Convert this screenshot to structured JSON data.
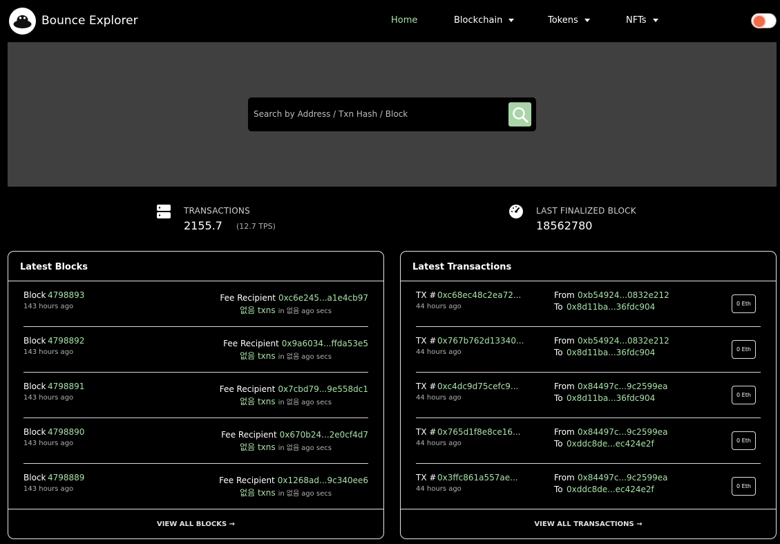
{
  "nav": {
    "brand": "Bounce Explorer",
    "home": "Home",
    "blockchain": "Blockchain",
    "tokens": "Tokens",
    "nfts": "NFTs"
  },
  "search": {
    "placeholder": "Search by Address / Txn Hash / Block"
  },
  "stats": {
    "transactions_label": "TRANSACTIONS",
    "transactions_value": "2155.7",
    "transactions_tps": "(12.7 TPS)",
    "finalized_label": "LAST FINALIZED BLOCK",
    "finalized_value": "18562780"
  },
  "blocks": {
    "title": "Latest Blocks",
    "view_all": "VIEW ALL BLOCKS →",
    "items": [
      {
        "label": "Block",
        "number": "4798893",
        "age": "143 hours ago",
        "fee_label": "Fee Recipient",
        "fee": "0xc6e245...a1e4cb97",
        "txns": "없음 txns",
        "in_label": "in",
        "in_value": "없음",
        "secs": "ago secs"
      },
      {
        "label": "Block",
        "number": "4798892",
        "age": "143 hours ago",
        "fee_label": "Fee Recipient",
        "fee": "0x9a6034...ffda53e5",
        "txns": "없음 txns",
        "in_label": "in",
        "in_value": "없음",
        "secs": "ago secs"
      },
      {
        "label": "Block",
        "number": "4798891",
        "age": "143 hours ago",
        "fee_label": "Fee Recipient",
        "fee": "0x7cbd79...9e558dc1",
        "txns": "없음 txns",
        "in_label": "in",
        "in_value": "없음",
        "secs": "ago secs"
      },
      {
        "label": "Block",
        "number": "4798890",
        "age": "143 hours ago",
        "fee_label": "Fee Recipient",
        "fee": "0x670b24...2e0cf4d7",
        "txns": "없음 txns",
        "in_label": "in",
        "in_value": "없음",
        "secs": "ago secs"
      },
      {
        "label": "Block",
        "number": "4798889",
        "age": "143 hours ago",
        "fee_label": "Fee Recipient",
        "fee": "0x1268ad...9c340ee6",
        "txns": "없음 txns",
        "in_label": "in",
        "in_value": "없음",
        "secs": "ago secs"
      }
    ]
  },
  "transactions": {
    "title": "Latest Transactions",
    "view_all": "VIEW ALL TRANSACTIONS →",
    "items": [
      {
        "label": "TX #",
        "hash": "0xc68ec48c2ea72...",
        "age": "44 hours ago",
        "from_label": "From",
        "from": "0xb54924...0832e212",
        "to_label": "To",
        "to": "0x8d11ba...36fdc904",
        "value": "0 Eth"
      },
      {
        "label": "TX #",
        "hash": "0x767b762d13340...",
        "age": "44 hours ago",
        "from_label": "From",
        "from": "0xb54924...0832e212",
        "to_label": "To",
        "to": "0x8d11ba...36fdc904",
        "value": "0 Eth"
      },
      {
        "label": "TX #",
        "hash": "0xc4dc9d75cefc9...",
        "age": "44 hours ago",
        "from_label": "From",
        "from": "0x84497c...9c2599ea",
        "to_label": "To",
        "to": "0x8d11ba...36fdc904",
        "value": "0 Eth"
      },
      {
        "label": "TX #",
        "hash": "0x765d1f8e8ce16...",
        "age": "44 hours ago",
        "from_label": "From",
        "from": "0x84497c...9c2599ea",
        "to_label": "To",
        "to": "0xddc8de...ec424e2f",
        "value": "0 Eth"
      },
      {
        "label": "TX #",
        "hash": "0x3ffc861a557ae...",
        "age": "44 hours ago",
        "from_label": "From",
        "from": "0x84497c...9c2599ea",
        "to_label": "To",
        "to": "0xddc8de...ec424e2f",
        "value": "0 Eth"
      }
    ]
  }
}
